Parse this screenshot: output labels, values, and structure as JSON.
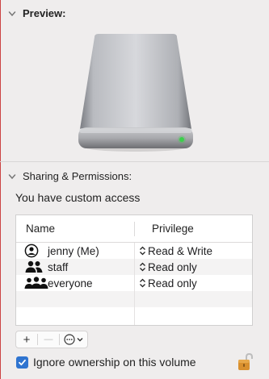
{
  "preview": {
    "title": "Preview:"
  },
  "sharing": {
    "title": "Sharing & Permissions:",
    "access_text": "You have custom access",
    "columns": {
      "name": "Name",
      "privilege": "Privilege"
    },
    "rows": [
      {
        "name": "jenny (Me)",
        "privilege": "Read & Write",
        "icon": "person-circle-icon"
      },
      {
        "name": "staff",
        "privilege": "Read only",
        "icon": "two-people-icon"
      },
      {
        "name": "everyone",
        "privilege": "Read only",
        "icon": "three-people-icon"
      }
    ],
    "buttons": {
      "add": "+",
      "remove": "—"
    },
    "ignore_ownership": {
      "label": "Ignore ownership on this volume",
      "checked": true
    }
  },
  "colors": {
    "accent": "#2f74d0",
    "lock": "#d9902f",
    "drive_led": "#3bd14a"
  }
}
